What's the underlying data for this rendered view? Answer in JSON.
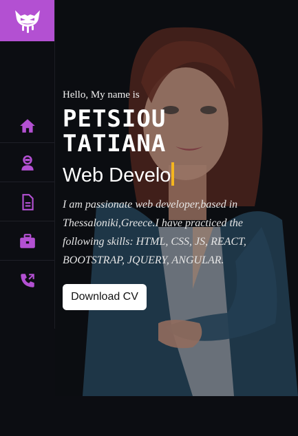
{
  "sidebar": {
    "logo_icon": "devil-face-logo",
    "accent": "#b350d2",
    "items": [
      {
        "icon": "home-icon"
      },
      {
        "icon": "user-icon"
      },
      {
        "icon": "document-icon"
      },
      {
        "icon": "briefcase-icon"
      },
      {
        "icon": "phone-icon"
      }
    ]
  },
  "hero": {
    "greeting": "Hello, My name is",
    "first_name": "PETSIOU",
    "last_name": "TATIANA",
    "role_typed": "Web Develo",
    "bio": "I am passionate web developer,based in Thessaloniki,Greece.I have practiced the following skills: HTML, CSS, JS, REACT, BOOTSTRAP, JQUERY, ANGULAR.",
    "cv_button": "Download CV",
    "cursor_color": "#f4b51f"
  }
}
